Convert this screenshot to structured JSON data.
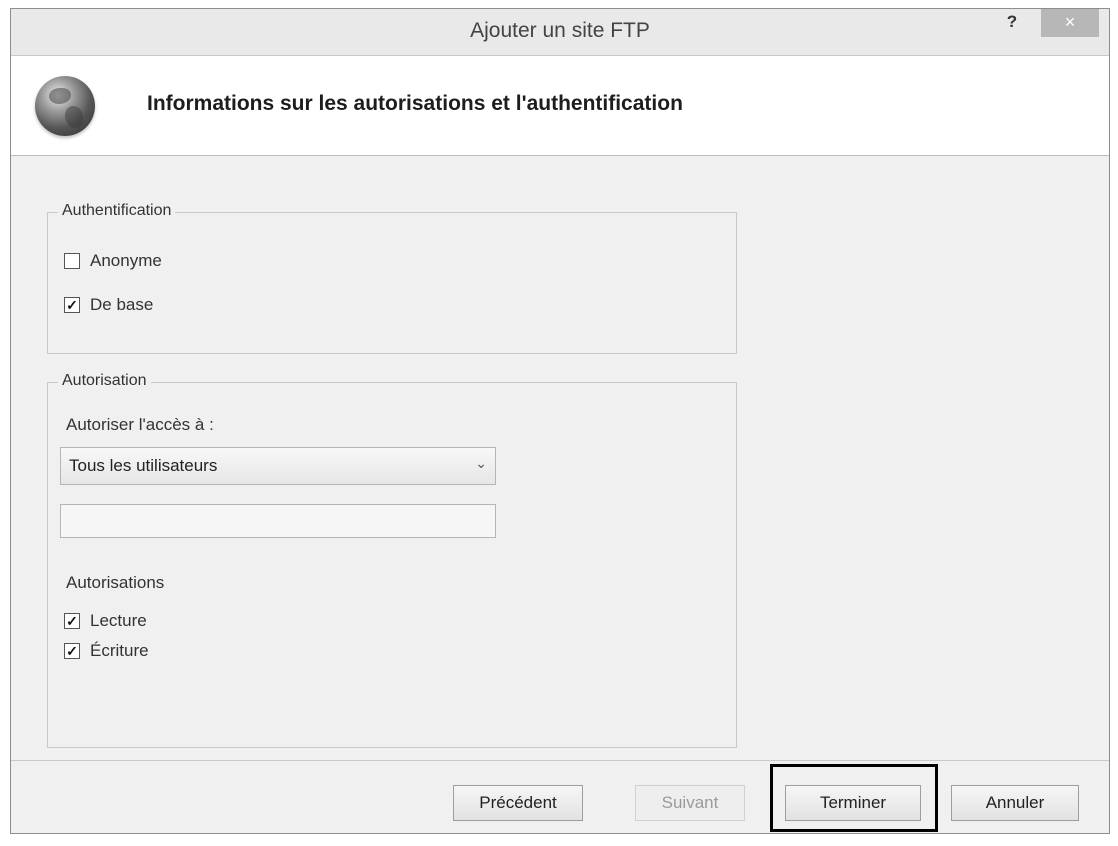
{
  "window": {
    "title": "Ajouter un site FTP",
    "help_label": "?",
    "close_label": "×"
  },
  "banner": {
    "heading": "Informations sur les autorisations et l'authentification",
    "icon": "globe-icon"
  },
  "authentication": {
    "legend": "Authentification",
    "options": [
      {
        "label": "Anonyme",
        "checked": false
      },
      {
        "label": "De base",
        "checked": true
      }
    ]
  },
  "authorization": {
    "legend": "Autorisation",
    "allow_access_label": "Autoriser l'accès à :",
    "allow_access_value": "Tous les utilisateurs",
    "user_field_value": "",
    "permissions_label": "Autorisations",
    "permissions": [
      {
        "label": "Lecture",
        "checked": true
      },
      {
        "label": "Écriture",
        "checked": true
      }
    ]
  },
  "buttons": {
    "previous": "Précédent",
    "next": "Suivant",
    "finish": "Terminer",
    "cancel": "Annuler"
  }
}
